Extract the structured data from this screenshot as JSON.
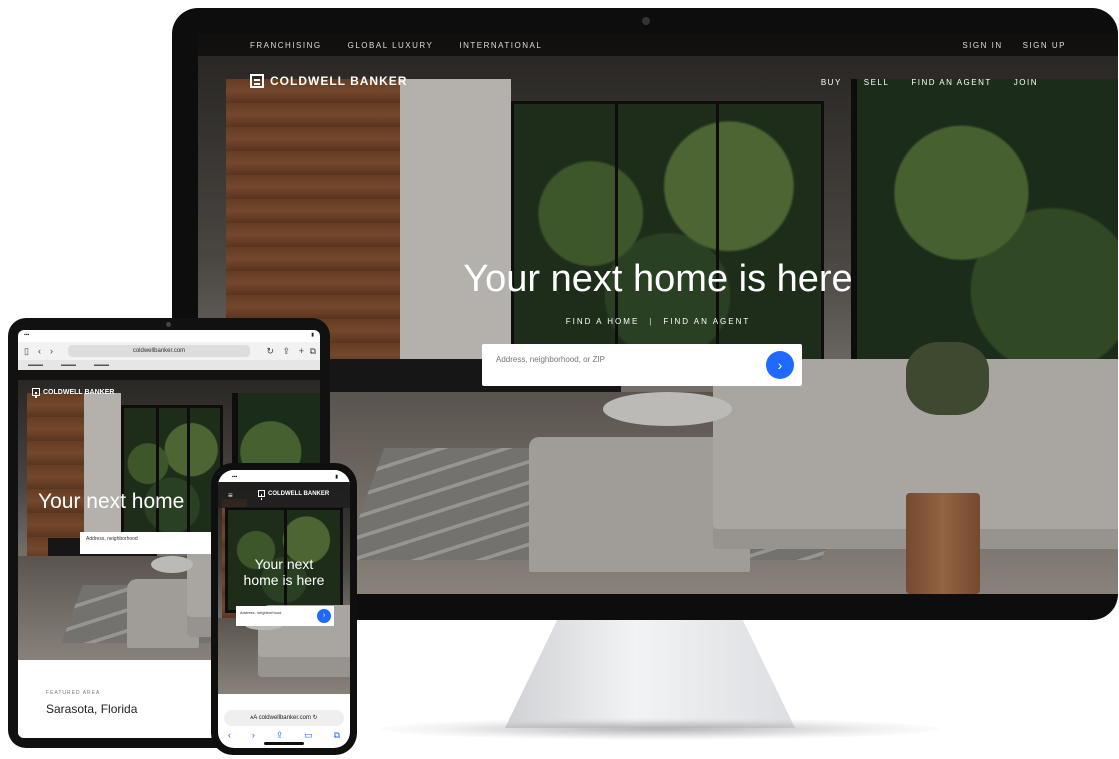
{
  "desktop": {
    "topbar_links": [
      "FRANCHISING",
      "GLOBAL LUXURY",
      "INTERNATIONAL"
    ],
    "topbar_right": [
      "SIGN IN",
      "SIGN UP"
    ],
    "logo_text": "COLDWELL BANKER",
    "nav_menu": [
      "BUY",
      "SELL",
      "FIND AN AGENT",
      "JOIN"
    ],
    "hero_title": "Your next home is here",
    "hero_tabs": [
      "FIND A HOME",
      "FIND AN AGENT"
    ],
    "search_placeholder": "Address, neighborhood, or ZIP",
    "search_button_icon": "chevron-right-icon",
    "accent_color": "#1f69ff"
  },
  "tablet": {
    "url": "coldwellbanker.com",
    "logo_text": "COLDWELL BANKER",
    "hero_title": "Your next home",
    "search_line1": "Address, neighborhood",
    "search_line2": "",
    "eyebrow": "FEATURED AREA",
    "city": "Sarasota, Florida"
  },
  "phone": {
    "logo_text": "COLDWELL BANKER",
    "hero_line1": "Your next",
    "hero_line2": "home is here",
    "search_line1": "Address, neighborhood",
    "search_line2": "",
    "url": "coldwellbanker.com"
  }
}
